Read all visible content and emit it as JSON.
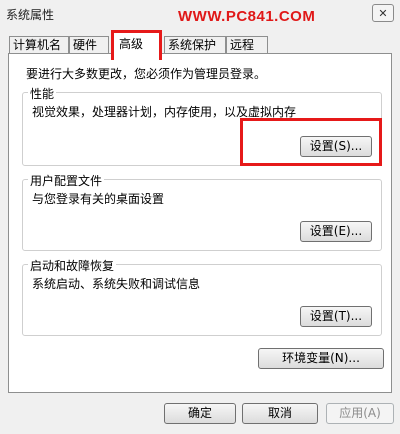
{
  "window": {
    "title": "系统属性",
    "watermark": "WWW.PC841.COM",
    "close_glyph": "✕"
  },
  "tabs": [
    {
      "label": "计算机名"
    },
    {
      "label": "硬件"
    },
    {
      "label": "高级",
      "active": true
    },
    {
      "label": "系统保护"
    },
    {
      "label": "远程"
    }
  ],
  "panel": {
    "admin_note": "要进行大多数更改，您必须作为管理员登录。",
    "performance": {
      "title": "性能",
      "desc": "视觉效果，处理器计划，内存使用，以及虚拟内存",
      "button": "设置(S)..."
    },
    "user_profiles": {
      "title": "用户配置文件",
      "desc": "与您登录有关的桌面设置",
      "button": "设置(E)..."
    },
    "startup_recovery": {
      "title": "启动和故障恢复",
      "desc": "系统启动、系统失败和调试信息",
      "button": "设置(T)..."
    },
    "env_button": "环境变量(N)..."
  },
  "footer": {
    "ok": "确定",
    "cancel": "取消",
    "apply": "应用(A)"
  },
  "colors": {
    "highlight": "#e61919",
    "watermark": "#e01818"
  }
}
